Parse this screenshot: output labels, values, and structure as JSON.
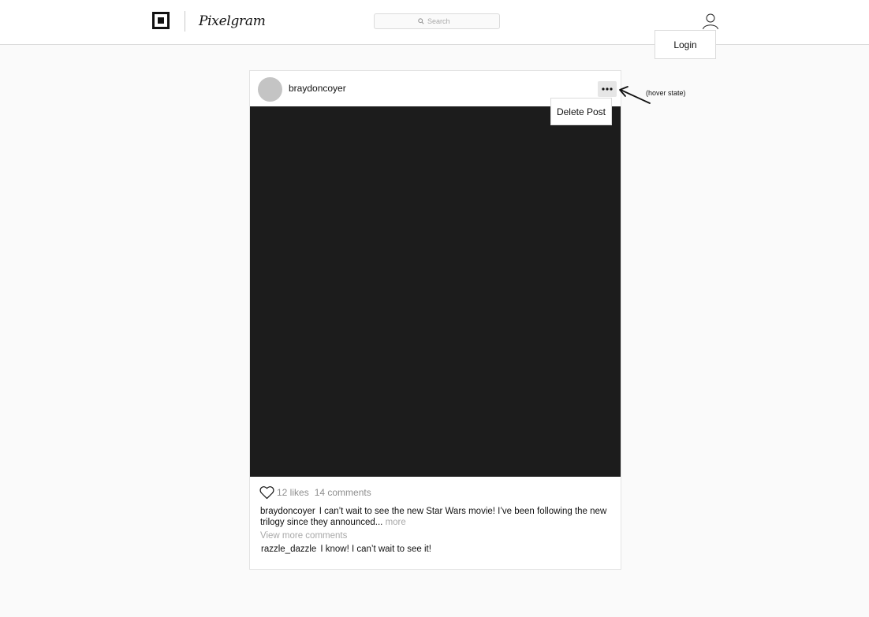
{
  "app": {
    "brand": "Pixelgram"
  },
  "search": {
    "placeholder": "Search"
  },
  "account": {
    "login_label": "Login"
  },
  "post": {
    "username": "braydoncoyer",
    "menu": {
      "delete_label": "Delete Post"
    },
    "likes": "12 likes",
    "comments_count": "14 comments",
    "caption": {
      "user": "braydoncoyer",
      "text": "I can’t wait to see the new Star Wars movie! I’ve been following the new trilogy since they announced...",
      "more_label": "more"
    },
    "view_more_comments": "View more comments",
    "comments": [
      {
        "user": "razzle_dazzle",
        "text": "I know! I can’t wait to see it!"
      }
    ]
  },
  "annotation": {
    "text": "(hover state)"
  },
  "icons": {
    "logo": "logo-icon",
    "search": "search-icon",
    "user": "user-icon",
    "more": "more-dots-icon",
    "like": "heart-icon",
    "annotation_arrow": "arrow-icon"
  },
  "colors": {
    "background": "#fafafa",
    "image_placeholder": "#1c1c1c",
    "muted_text": "#8e8e8e",
    "border": "#dbdbdb"
  }
}
